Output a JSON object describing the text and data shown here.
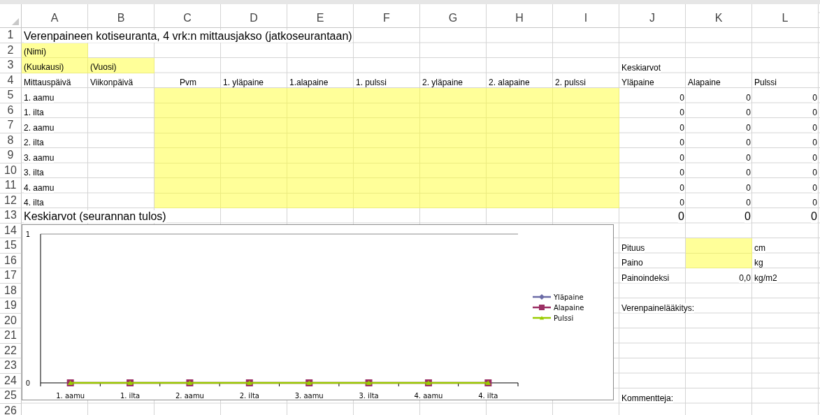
{
  "columns": [
    "A",
    "B",
    "C",
    "D",
    "E",
    "F",
    "G",
    "H",
    "I",
    "J",
    "K",
    "L"
  ],
  "rows": [
    {
      "number": "1",
      "cells": [
        {
          "kind": "title",
          "text": "Verenpaineen kotiseuranta, 4 vrk:n mittausjakso (jatkoseurantaan)"
        },
        {},
        {},
        {},
        {},
        {},
        {},
        {},
        {},
        {},
        {},
        {}
      ]
    },
    {
      "number": "2",
      "cells": [
        {
          "kind": "input",
          "text": "(Nimi)"
        },
        {},
        {},
        {},
        {},
        {},
        {},
        {},
        {},
        {},
        {},
        {}
      ]
    },
    {
      "number": "3",
      "cells": [
        {
          "kind": "input",
          "text": "(Kuukausi)"
        },
        {
          "kind": "input",
          "text": "(Vuosi)"
        },
        {},
        {},
        {},
        {},
        {},
        {},
        {},
        {
          "kind": "text",
          "text": "Keskiarvot"
        },
        {},
        {}
      ]
    },
    {
      "number": "4",
      "cells": [
        {
          "kind": "text",
          "text": "Mittauspäivä"
        },
        {
          "kind": "text",
          "text": "Viikonpäivä"
        },
        {
          "kind": "centered",
          "text": "Pvm"
        },
        {
          "kind": "text",
          "text": "1. yläpaine"
        },
        {
          "kind": "text",
          "text": "1.alapaine"
        },
        {
          "kind": "text",
          "text": "1. pulssi"
        },
        {
          "kind": "text",
          "text": "2. yläpaine"
        },
        {
          "kind": "text",
          "text": "2. alapaine"
        },
        {
          "kind": "text",
          "text": "2. pulssi"
        },
        {
          "kind": "text",
          "text": "Yläpaine"
        },
        {
          "kind": "text",
          "text": "Alapaine"
        },
        {
          "kind": "text",
          "text": "Pulssi"
        }
      ]
    },
    {
      "number": "5",
      "cells": [
        {
          "kind": "text",
          "text": "1. aamu"
        },
        {},
        {
          "kind": "input"
        },
        {
          "kind": "input"
        },
        {
          "kind": "input"
        },
        {
          "kind": "input"
        },
        {
          "kind": "input"
        },
        {
          "kind": "input"
        },
        {
          "kind": "input"
        },
        {
          "kind": "number",
          "text": "0"
        },
        {
          "kind": "number",
          "text": "0"
        },
        {
          "kind": "number",
          "text": "0"
        }
      ]
    },
    {
      "number": "6",
      "cells": [
        {
          "kind": "text",
          "text": "1. ilta"
        },
        {},
        {
          "kind": "input"
        },
        {
          "kind": "input"
        },
        {
          "kind": "input"
        },
        {
          "kind": "input"
        },
        {
          "kind": "input"
        },
        {
          "kind": "input"
        },
        {
          "kind": "input"
        },
        {
          "kind": "number",
          "text": "0"
        },
        {
          "kind": "number",
          "text": "0"
        },
        {
          "kind": "number",
          "text": "0"
        }
      ]
    },
    {
      "number": "7",
      "cells": [
        {
          "kind": "text",
          "text": "2. aamu"
        },
        {},
        {
          "kind": "input"
        },
        {
          "kind": "input"
        },
        {
          "kind": "input"
        },
        {
          "kind": "input"
        },
        {
          "kind": "input"
        },
        {
          "kind": "input"
        },
        {
          "kind": "input"
        },
        {
          "kind": "number",
          "text": "0"
        },
        {
          "kind": "number",
          "text": "0"
        },
        {
          "kind": "number",
          "text": "0"
        }
      ]
    },
    {
      "number": "8",
      "cells": [
        {
          "kind": "text",
          "text": "2. ilta"
        },
        {},
        {
          "kind": "input"
        },
        {
          "kind": "input"
        },
        {
          "kind": "input"
        },
        {
          "kind": "input"
        },
        {
          "kind": "input"
        },
        {
          "kind": "input"
        },
        {
          "kind": "input"
        },
        {
          "kind": "number",
          "text": "0"
        },
        {
          "kind": "number",
          "text": "0"
        },
        {
          "kind": "number",
          "text": "0"
        }
      ]
    },
    {
      "number": "9",
      "cells": [
        {
          "kind": "text",
          "text": "3. aamu"
        },
        {},
        {
          "kind": "input"
        },
        {
          "kind": "input"
        },
        {
          "kind": "input"
        },
        {
          "kind": "input"
        },
        {
          "kind": "input"
        },
        {
          "kind": "input"
        },
        {
          "kind": "input"
        },
        {
          "kind": "number",
          "text": "0"
        },
        {
          "kind": "number",
          "text": "0"
        },
        {
          "kind": "number",
          "text": "0"
        }
      ]
    },
    {
      "number": "10",
      "cells": [
        {
          "kind": "text",
          "text": "3. ilta"
        },
        {},
        {
          "kind": "input"
        },
        {
          "kind": "input"
        },
        {
          "kind": "input"
        },
        {
          "kind": "input"
        },
        {
          "kind": "input"
        },
        {
          "kind": "input"
        },
        {
          "kind": "input"
        },
        {
          "kind": "number",
          "text": "0"
        },
        {
          "kind": "number",
          "text": "0"
        },
        {
          "kind": "number",
          "text": "0"
        }
      ]
    },
    {
      "number": "11",
      "cells": [
        {
          "kind": "text",
          "text": "4. aamu"
        },
        {},
        {
          "kind": "input"
        },
        {
          "kind": "input"
        },
        {
          "kind": "input"
        },
        {
          "kind": "input"
        },
        {
          "kind": "input"
        },
        {
          "kind": "input"
        },
        {
          "kind": "input"
        },
        {
          "kind": "number",
          "text": "0"
        },
        {
          "kind": "number",
          "text": "0"
        },
        {
          "kind": "number",
          "text": "0"
        }
      ]
    },
    {
      "number": "12",
      "cells": [
        {
          "kind": "text",
          "text": "4. ilta"
        },
        {},
        {
          "kind": "input"
        },
        {
          "kind": "input"
        },
        {
          "kind": "input"
        },
        {
          "kind": "input"
        },
        {
          "kind": "input"
        },
        {
          "kind": "input"
        },
        {
          "kind": "input"
        },
        {
          "kind": "number",
          "text": "0"
        },
        {
          "kind": "number",
          "text": "0"
        },
        {
          "kind": "number",
          "text": "0"
        }
      ]
    },
    {
      "number": "13",
      "cells": [
        {
          "kind": "title",
          "text": "Keskiarvot (seurannan tulos)"
        },
        {},
        {},
        {},
        {},
        {},
        {},
        {},
        {},
        {
          "kind": "total",
          "text": "0"
        },
        {
          "kind": "total",
          "text": "0"
        },
        {
          "kind": "total",
          "text": "0"
        }
      ]
    },
    {
      "number": "14",
      "cells": [
        {},
        {},
        {},
        {},
        {},
        {},
        {},
        {},
        {},
        {},
        {},
        {}
      ]
    },
    {
      "number": "15",
      "cells": [
        {},
        {},
        {},
        {},
        {},
        {},
        {},
        {},
        {},
        {
          "kind": "text",
          "text": "Pituus"
        },
        {
          "kind": "input"
        },
        {
          "kind": "text",
          "text": "cm"
        }
      ]
    },
    {
      "number": "16",
      "cells": [
        {},
        {},
        {},
        {},
        {},
        {},
        {},
        {},
        {},
        {
          "kind": "text",
          "text": "Paino"
        },
        {
          "kind": "input"
        },
        {
          "kind": "text",
          "text": "kg"
        }
      ]
    },
    {
      "number": "17",
      "cells": [
        {},
        {},
        {},
        {},
        {},
        {},
        {},
        {},
        {},
        {
          "kind": "text",
          "text": "Painoindeksi"
        },
        {
          "kind": "number",
          "text": "0,0"
        },
        {
          "kind": "text",
          "text": "kg/m2"
        }
      ]
    },
    {
      "number": "18",
      "cells": [
        {},
        {},
        {},
        {},
        {},
        {},
        {},
        {},
        {},
        {},
        {},
        {}
      ]
    },
    {
      "number": "19",
      "cells": [
        {},
        {},
        {},
        {},
        {},
        {},
        {},
        {},
        {},
        {
          "kind": "text",
          "text": "Verenpainelääkitys:"
        },
        {},
        {}
      ]
    },
    {
      "number": "20",
      "cells": [
        {},
        {},
        {},
        {},
        {},
        {},
        {},
        {},
        {},
        {},
        {},
        {}
      ]
    },
    {
      "number": "21",
      "cells": [
        {},
        {},
        {},
        {},
        {},
        {},
        {},
        {},
        {},
        {},
        {},
        {}
      ]
    },
    {
      "number": "22",
      "cells": [
        {},
        {},
        {},
        {},
        {},
        {},
        {},
        {},
        {},
        {},
        {},
        {}
      ]
    },
    {
      "number": "23",
      "cells": [
        {},
        {},
        {},
        {},
        {},
        {},
        {},
        {},
        {},
        {},
        {},
        {}
      ]
    },
    {
      "number": "24",
      "cells": [
        {},
        {},
        {},
        {},
        {},
        {},
        {},
        {},
        {},
        {},
        {},
        {}
      ]
    },
    {
      "number": "25",
      "cells": [
        {},
        {},
        {},
        {},
        {},
        {},
        {},
        {},
        {},
        {
          "kind": "text",
          "text": "Kommentteja:"
        },
        {},
        {}
      ]
    },
    {
      "number": "26",
      "cells": [
        {},
        {},
        {},
        {},
        {},
        {},
        {},
        {},
        {},
        {},
        {},
        {}
      ]
    }
  ],
  "chart": {
    "chart_data": {
      "type": "line",
      "categories": [
        "1. aamu",
        "1. ilta",
        "2. aamu",
        "2. ilta",
        "3. aamu",
        "3. ilta",
        "4. aamu",
        "4. ilta"
      ],
      "ylim": [
        0,
        1
      ],
      "yticks": [
        0,
        1
      ],
      "legend": "right",
      "series": [
        {
          "name": "Yläpaine",
          "color": "#6b6ba6",
          "marker": "diamond",
          "values": [
            null,
            null,
            null,
            null,
            null,
            null,
            null,
            null
          ]
        },
        {
          "name": "Alapaine",
          "color": "#9b2f64",
          "marker": "square",
          "values": [
            0,
            0,
            0,
            0,
            0,
            0,
            0,
            0
          ]
        },
        {
          "name": "Pulssi",
          "color": "#99cc00",
          "marker": "triangle",
          "values": [
            0,
            0,
            0,
            0,
            0,
            0,
            0,
            0
          ]
        }
      ]
    }
  }
}
